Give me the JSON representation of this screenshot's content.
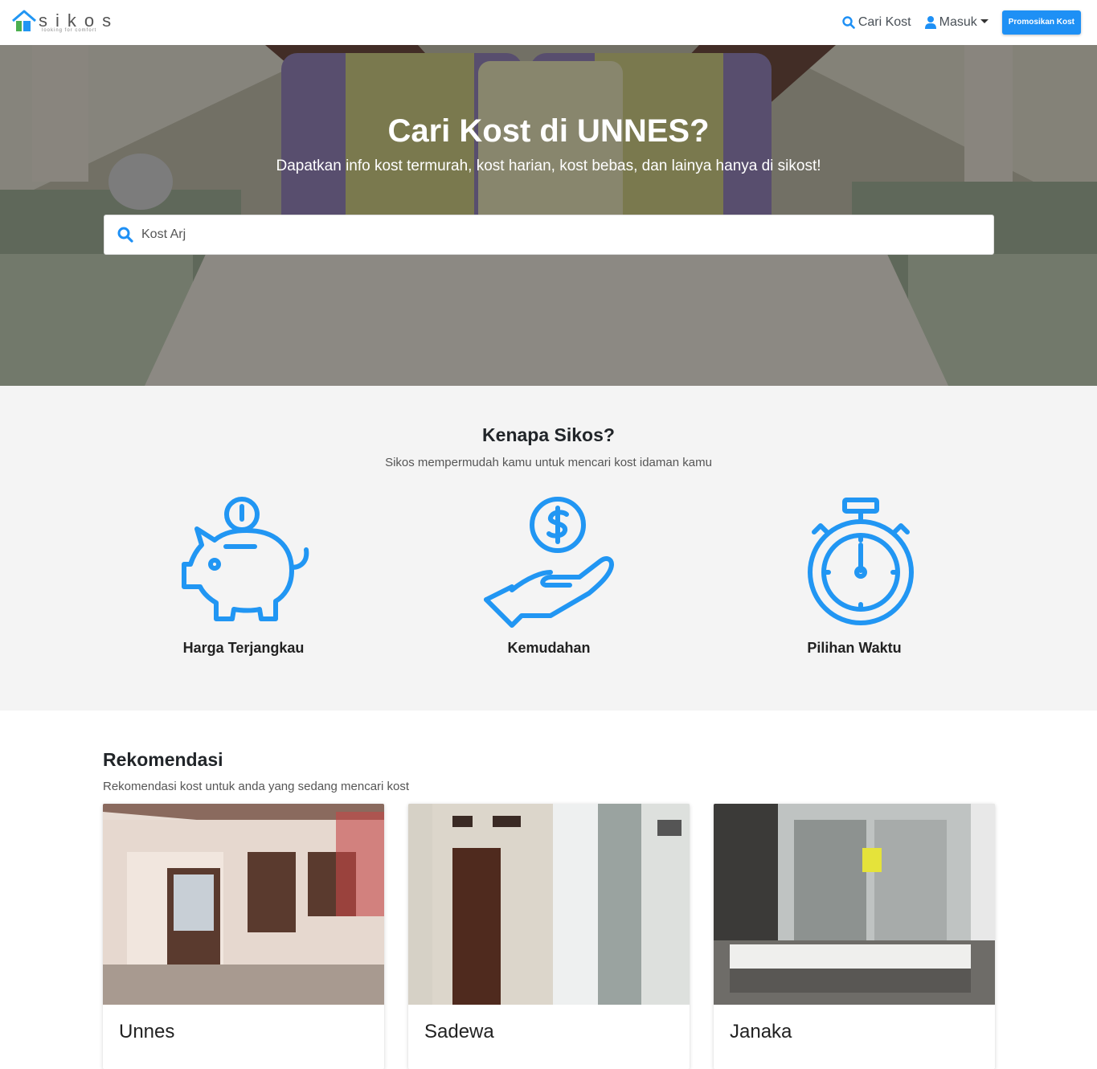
{
  "navbar": {
    "logo_text": "sikos",
    "logo_tagline": "looking for comfort",
    "cari_kost_label": "Cari Kost",
    "masuk_label": "Masuk",
    "promo_button_label": "Promosikan Kost"
  },
  "hero": {
    "title": "Cari Kost di UNNES?",
    "subtitle": "Dapatkan info kost termurah, kost harian, kost bebas, dan lainya hanya di sikost!",
    "search_value": "Kost Arj"
  },
  "why": {
    "title": "Kenapa Sikos?",
    "subtitle": "Sikos mempermudah kamu untuk mencari kost idaman kamu",
    "features": [
      {
        "icon": "piggy-bank-icon",
        "label": "Harga Terjangkau"
      },
      {
        "icon": "hand-coin-icon",
        "label": "Kemudahan"
      },
      {
        "icon": "stopwatch-icon",
        "label": "Pilihan Waktu"
      }
    ]
  },
  "recommendations": {
    "title": "Rekomendasi",
    "subtitle": "Rekomendasi kost untuk anda yang sedang mencari kost",
    "cards": [
      {
        "name": "Unnes"
      },
      {
        "name": "Sadewa"
      },
      {
        "name": "Janaka"
      }
    ]
  },
  "colors": {
    "accent": "#1e90f5",
    "icon_blue": "#2196f3",
    "section_bg": "#f4f4f4"
  }
}
